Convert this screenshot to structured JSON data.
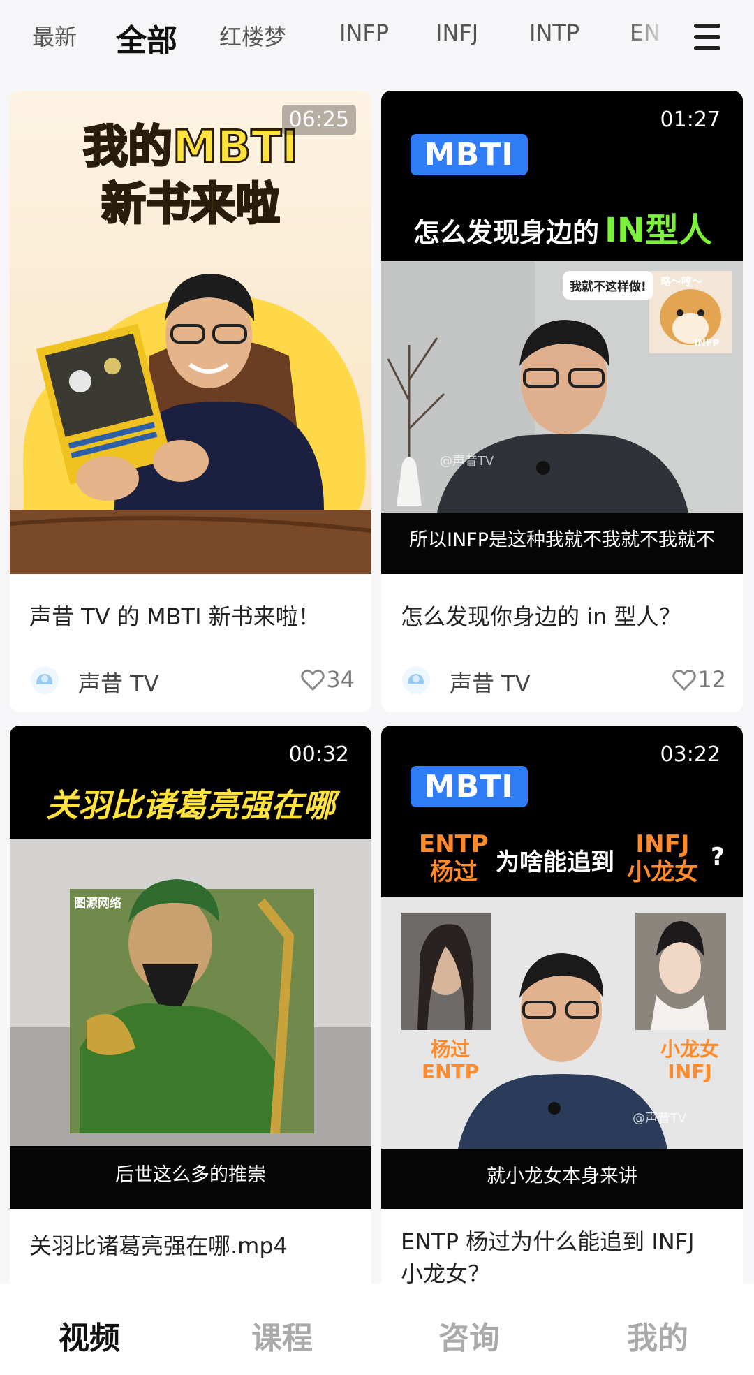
{
  "tabs": {
    "items": [
      "最新",
      "全部",
      "红楼梦",
      "INFP",
      "INFJ",
      "INTP",
      "EN"
    ],
    "active_index": 1
  },
  "cards": [
    {
      "duration": "06:25",
      "thumb_heading_line1": "我的MBTI",
      "thumb_heading_line2": "新书来啦",
      "title": "声昔 TV 的 MBTI 新书来啦！",
      "author": "声昔 TV",
      "likes": "34"
    },
    {
      "duration": "01:27",
      "thumb_tag": "MBTI",
      "thumb_heading_white": "怎么发现身边的",
      "thumb_heading_green": "IN型人",
      "thumb_bubble": "我就不这样做!",
      "thumb_sticker_top": "略～哼～",
      "thumb_sticker_bottom": "INFP",
      "thumb_watermark": "@声昔TV",
      "thumb_subtitle": "所以INFP是这种我就不我就不我就不",
      "title": "怎么发现你身边的 in 型人？",
      "author": "声昔 TV",
      "likes": "12"
    },
    {
      "duration": "00:32",
      "thumb_heading": "关羽比诸葛亮强在哪",
      "thumb_source": "图源网络",
      "thumb_subtitle": "后世这么多的推崇",
      "title": "关羽比诸葛亮强在哪.mp4"
    },
    {
      "duration": "03:22",
      "thumb_tag": "MBTI",
      "thumb_left_top": "ENTP",
      "thumb_left_bottom": "杨过",
      "thumb_middle": "为啥能追到",
      "thumb_right_top": "INFJ",
      "thumb_right_bottom": "小龙女",
      "thumb_q": "?",
      "thumb_caption_left_1": "杨过",
      "thumb_caption_left_2": "ENTP",
      "thumb_caption_right_1": "小龙女",
      "thumb_caption_right_2": "INFJ",
      "thumb_watermark": "@声昔TV",
      "thumb_subtitle": "就小龙女本身来讲",
      "title": "ENTP 杨过为什么能追到 INFJ 小龙女？"
    }
  ],
  "bottom_nav": {
    "items": [
      "视频",
      "课程",
      "咨询",
      "我的"
    ],
    "active_index": 0
  },
  "colors": {
    "accent_green": "#c6ef6a",
    "mbti_blue": "#2f7cf6",
    "title_yellow": "#ffe23b",
    "heading_green": "#7df23a",
    "orange": "#ff8a2a"
  }
}
